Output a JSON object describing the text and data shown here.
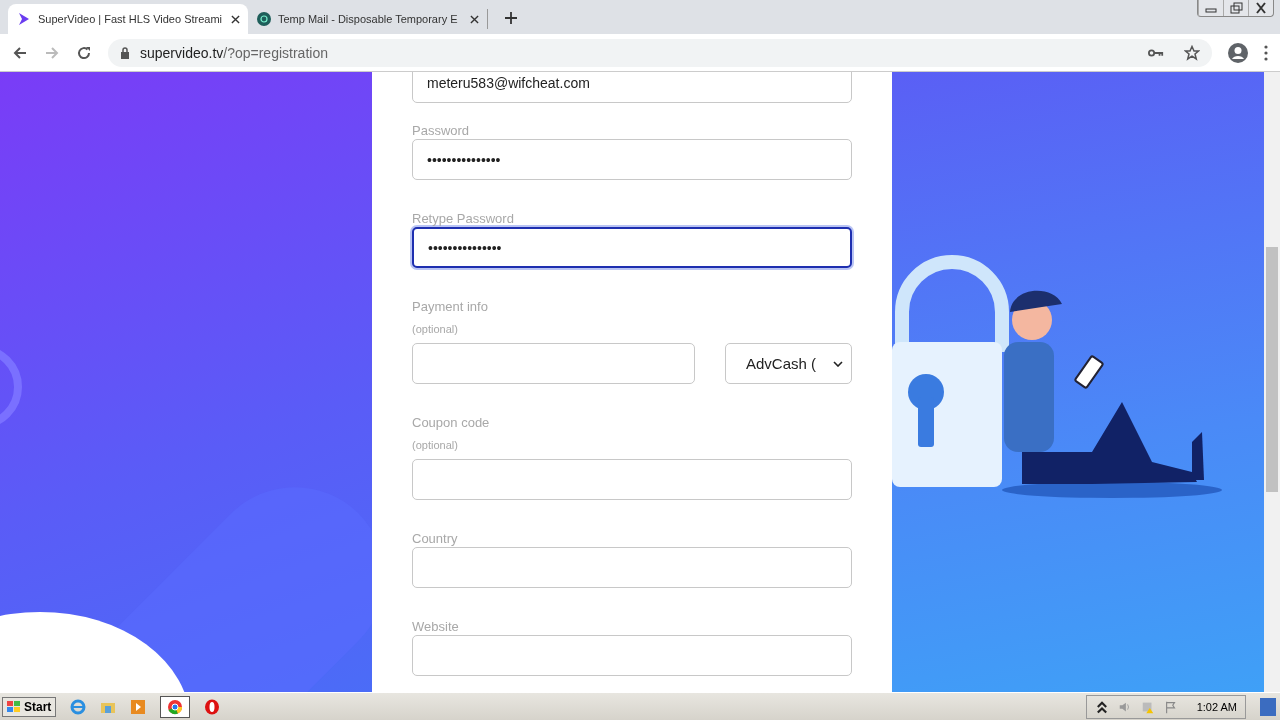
{
  "browser": {
    "tabs": [
      {
        "title": "SuperVideo | Fast HLS Video Streami",
        "selected": true
      },
      {
        "title": "Temp Mail - Disposable Temporary E",
        "selected": false
      }
    ],
    "address": {
      "domain": "supervideo.tv",
      "path": "/?op=registration"
    }
  },
  "form": {
    "fields": [
      {
        "kind": "text",
        "value": "meteru583@wifcheat.com",
        "focused": false
      },
      {
        "kind": "text",
        "label": "Password",
        "value": "•••••••••••••••",
        "focused": false
      },
      {
        "kind": "text",
        "label": "Retype Password",
        "value": "•••••••••••••••",
        "focused": true
      },
      {
        "kind": "payment",
        "label": "Payment info",
        "hint": "(optional)",
        "select": "AdvCash (",
        "focused": false
      },
      {
        "kind": "text",
        "label": "Coupon code",
        "hint": "(optional)",
        "focused": false
      },
      {
        "kind": "text",
        "label": "Country",
        "focused": false
      },
      {
        "kind": "text",
        "label": "Website",
        "focused": false
      }
    ]
  },
  "taskbar": {
    "start": "Start",
    "clock": "1:02 AM"
  }
}
